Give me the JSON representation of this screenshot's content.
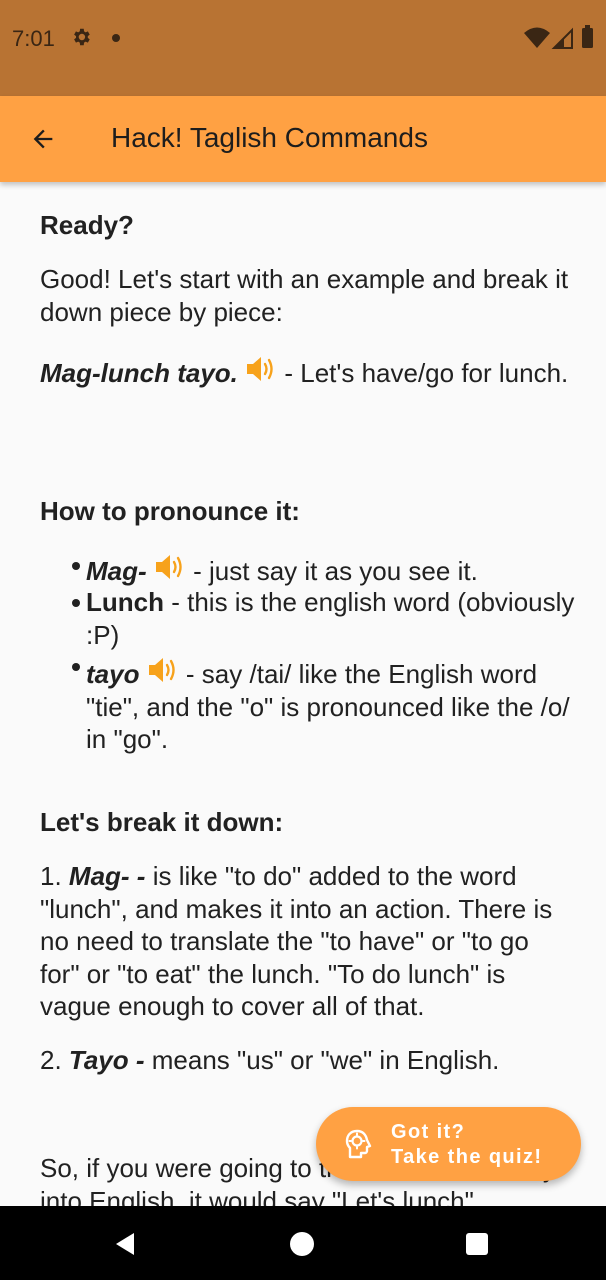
{
  "status_bar": {
    "time": "7:01",
    "icons": [
      "settings-icon",
      "notification-dot-icon",
      "wifi-icon",
      "signal-icon",
      "battery-icon"
    ]
  },
  "app_bar": {
    "title": "Hack! Taglish Commands",
    "back_icon": "arrow-back-icon"
  },
  "content": {
    "ready_heading": "Ready?",
    "intro": "Good! Let's start with an example and break it down piece by piece:",
    "example": {
      "phrase": "Mag-lunch tayo.",
      "speaker_icon": "speaker-icon",
      "translation": " - Let's have/go for lunch."
    },
    "pronounce_heading": "How to pronounce it:",
    "pronounce_items": [
      {
        "term": "Mag-",
        "has_audio": true,
        "description": " - just say it as you see it."
      },
      {
        "term": "Lunch",
        "has_audio": false,
        "description": " - this is the english word (obviously :P)"
      },
      {
        "term": "tayo",
        "has_audio": true,
        "description": " - say /tai/ like the English word \"tie\", and the \"o\" is pronounced like the /o/ in \"go\"."
      }
    ],
    "breakdown_heading": "Let's break it down:",
    "breakdown_items": [
      {
        "number": "1. ",
        "term": "Mag- -",
        "description": " is like \"to do\" added to the word \"lunch\", and makes it into an action. There is no need to translate the \"to have\" or \"to go for\" or \"to eat\" the lunch. \"To do lunch\" is vague enough to cover all of that."
      },
      {
        "number": "2. ",
        "term": "Tayo -",
        "description": " means \"us\" or \"we\" in English."
      }
    ],
    "conclusion_partial": "So, if you were going to translate this directly into English, it would say \"Let's lunch\"."
  },
  "fab": {
    "line1": "Got it?",
    "line2": "Take the quiz!",
    "icon": "lightbulb-head-icon"
  },
  "colors": {
    "status_bar": "#b87333",
    "app_bar": "#ffa143",
    "background": "#fafafa",
    "speaker_icon": "#f7a21b",
    "nav_bar": "#000000"
  },
  "nav_bar": {
    "icons": [
      "back-triangle-icon",
      "home-circle-icon",
      "recents-square-icon"
    ]
  }
}
